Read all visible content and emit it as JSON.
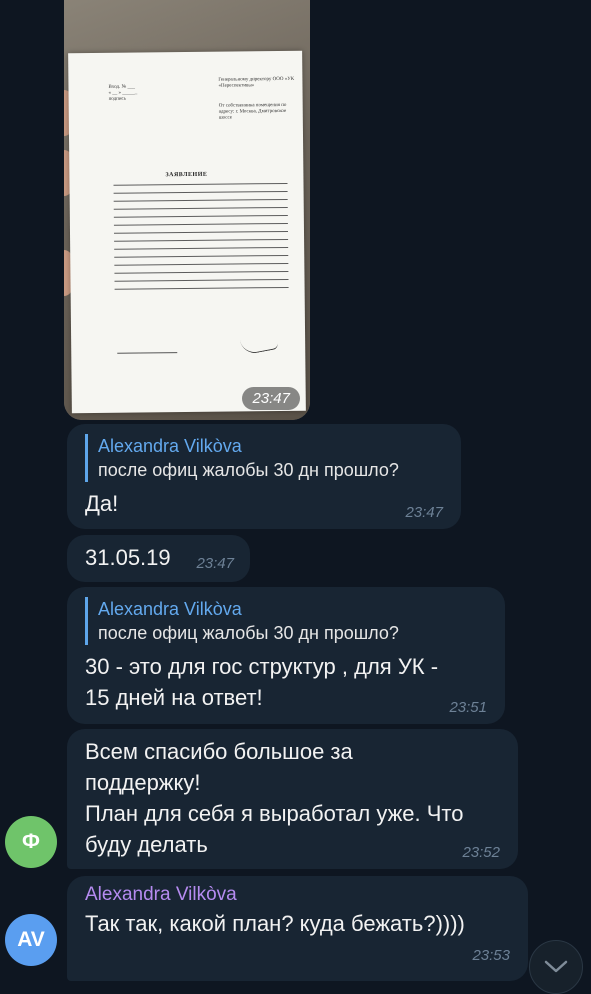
{
  "photo_message": {
    "time": "23:47",
    "document": {
      "title": "ЗАЯВЛЕНИЕ",
      "header": "Генеральному директору ООО «УК «Переспективы»",
      "from": "От собственника помещения по адресу: г. Москва, Дмитровское шоссе"
    }
  },
  "messages": [
    {
      "reply_name": "Alexandra Vilkòva",
      "reply_text": "после офиц жалобы 30 дн прошло?",
      "text": "Да!",
      "time": "23:47"
    },
    {
      "text": "31.05.19",
      "time": "23:47"
    },
    {
      "reply_name": "Alexandra Vilkòva",
      "reply_text": "после офиц жалобы 30 дн прошло?",
      "text_lines": [
        "30 - это для гос структур , для УК -",
        "15 дней на ответ!"
      ],
      "time": "23:51"
    },
    {
      "text_lines": [
        "Всем спасибо большое за",
        "поддержку!",
        "План для себя я выработал уже. Что",
        "буду делать"
      ],
      "time": "23:52",
      "avatar_letter": "Ф",
      "avatar_color": "#6fc46a"
    },
    {
      "sender": "Alexandra Vilkòva",
      "text": "Так так, какой план? куда бежать?))))",
      "time": "23:53",
      "avatar_letter": "AV",
      "avatar_color": "#5a9ef0"
    }
  ],
  "icons": {
    "scroll_down": "chevron-down-icon"
  }
}
